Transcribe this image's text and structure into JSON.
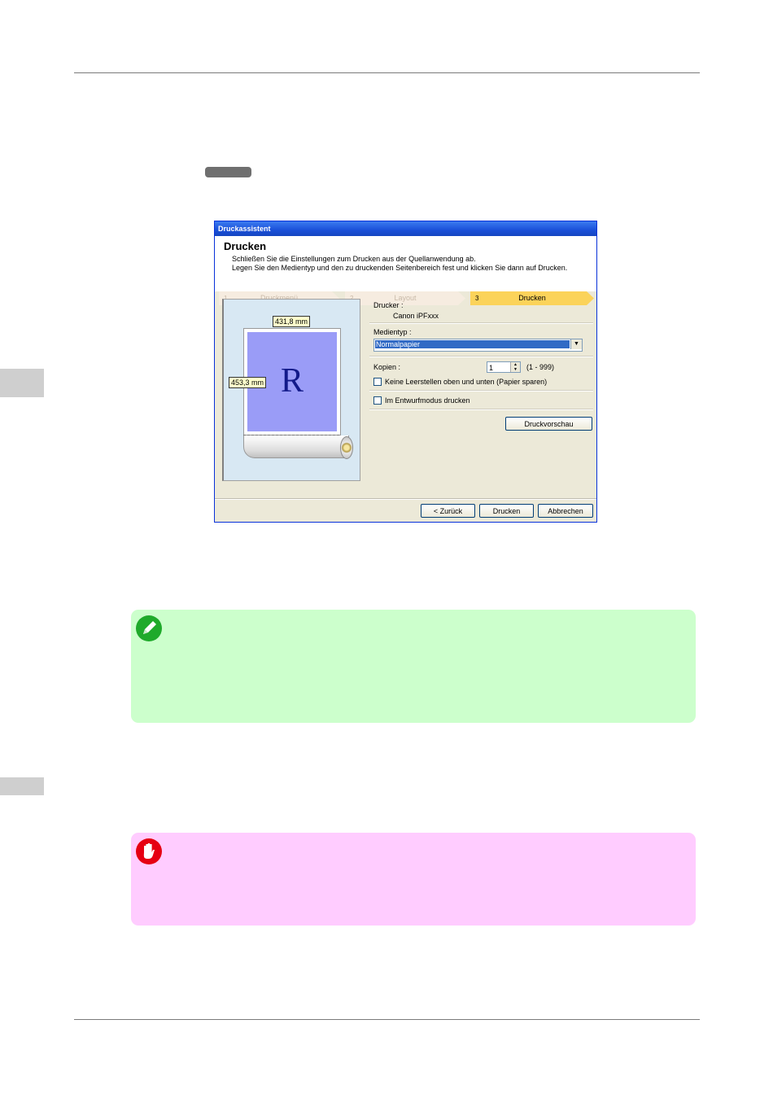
{
  "dialog": {
    "title": "Druckassistent",
    "heading": "Drucken",
    "line1": "Schließen Sie die Einstellungen zum Drucken aus der Quellanwendung ab.",
    "line2": "Legen Sie den Medientyp und den zu druckenden Seitenbereich fest und klicken Sie dann auf Drucken.",
    "steps": [
      {
        "num": "1",
        "label": "Druckmenü"
      },
      {
        "num": "2",
        "label": "Layout"
      },
      {
        "num": "3",
        "label": "Drucken"
      }
    ],
    "preview": {
      "width_label": "431,8 mm",
      "height_label": "453,3 mm",
      "letter": "R"
    },
    "printer_label": "Drucker :",
    "printer_value": "Canon iPFxxx",
    "media_label": "Medientyp :",
    "media_value": "Normalpapier",
    "copies_label": "Kopien :",
    "copies_value": "1",
    "copies_range": "(1 - 999)",
    "checkbox_no_margin": "Keine Leerstellen oben und unten (Papier sparen)",
    "checkbox_draft": "Im Entwurfmodus drucken",
    "preview_button": "Druckvorschau",
    "back_button": "< Zurück",
    "print_button": "Drucken",
    "cancel_button": "Abbrechen"
  },
  "colors": {
    "note_bg": "#ccffcc",
    "important_bg": "#ffccff",
    "note_icon": "#1faa2b",
    "important_icon": "#e60012"
  },
  "icons": {
    "note": "pencil-icon",
    "important": "stop-hand-icon"
  }
}
